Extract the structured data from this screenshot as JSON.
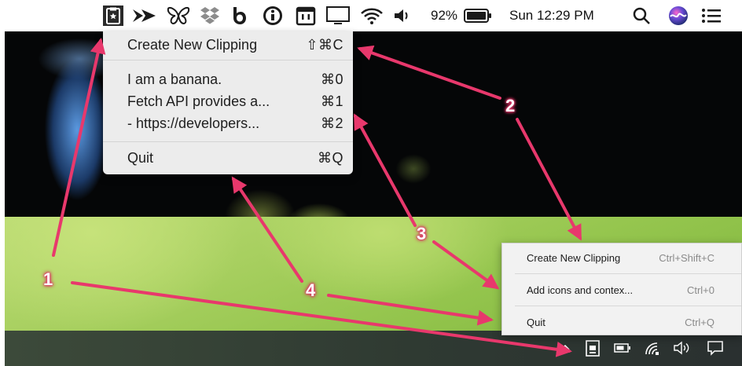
{
  "mac": {
    "menubar": {
      "battery_percent": "92%",
      "clock": "Sun 12:29 PM",
      "icons": [
        "clipboard-app-icon",
        "forward-arrow-icon",
        "butterfly-icon",
        "dropbox-icon",
        "b-app-icon",
        "info-icon",
        "calendar-icon",
        "monitor-icon",
        "wifi-icon",
        "volume-icon",
        "battery-icon",
        "search-icon",
        "siri-icon",
        "list-icon"
      ]
    },
    "menu": {
      "create": {
        "label": "Create New Clipping",
        "shortcut": "⇧⌘C"
      },
      "clippings": [
        {
          "label": "I am a banana.",
          "shortcut": "⌘0"
        },
        {
          "label": "Fetch API provides a...",
          "shortcut": "⌘1"
        },
        {
          "label": "- https://developers...",
          "shortcut": "⌘2"
        }
      ],
      "quit": {
        "label": "Quit",
        "shortcut": "⌘Q"
      }
    }
  },
  "windows": {
    "menu": {
      "create": {
        "label": "Create New Clipping",
        "shortcut": "Ctrl+Shift+C"
      },
      "clipping": {
        "label": "Add icons and contex...",
        "shortcut": "Ctrl+0"
      },
      "quit": {
        "label": "Quit",
        "shortcut": "Ctrl+Q"
      }
    },
    "tray_icons": [
      "chevron-up-icon",
      "clipboard-app-icon",
      "battery-icon",
      "network-icon",
      "volume-icon",
      "notification-icon"
    ]
  },
  "annotations": {
    "one": "1",
    "two": "2",
    "three": "3",
    "four": "4",
    "color": "#e8386c"
  }
}
